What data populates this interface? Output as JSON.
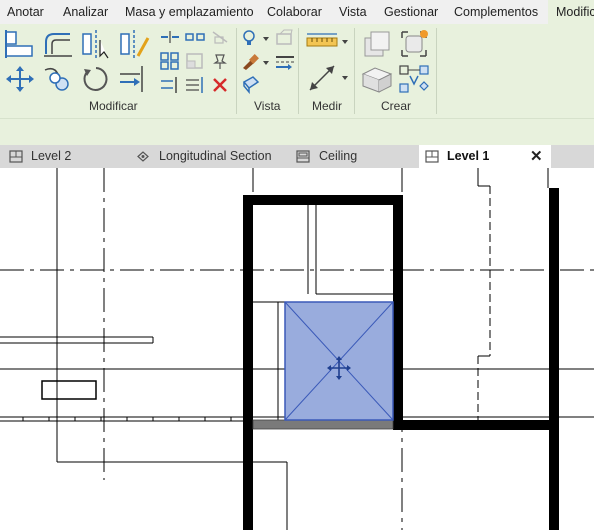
{
  "ribbon_tabs": [
    "Anotar",
    "Analizar",
    "Masa y emplazamiento",
    "Colaborar",
    "Vista",
    "Gestionar",
    "Complementos",
    "Modific"
  ],
  "panels": {
    "modificar": "Modificar",
    "vista": "Vista",
    "medir": "Medir",
    "crear": "Crear"
  },
  "view_tabs": [
    {
      "label": "Level 2",
      "icon": "floor-plan-icon"
    },
    {
      "label": "Longitudinal Section",
      "icon": "section-icon"
    },
    {
      "label": "Ceiling",
      "icon": "ceiling-plan-icon"
    },
    {
      "label": "Level 1",
      "icon": "floor-plan-icon"
    }
  ],
  "close_glyph": "✕",
  "colors": {
    "ribbon_bg": "#e8f1dd",
    "selection_fill": "#99acdd",
    "selection_stroke": "#3a59b8",
    "wall": "#000000"
  }
}
